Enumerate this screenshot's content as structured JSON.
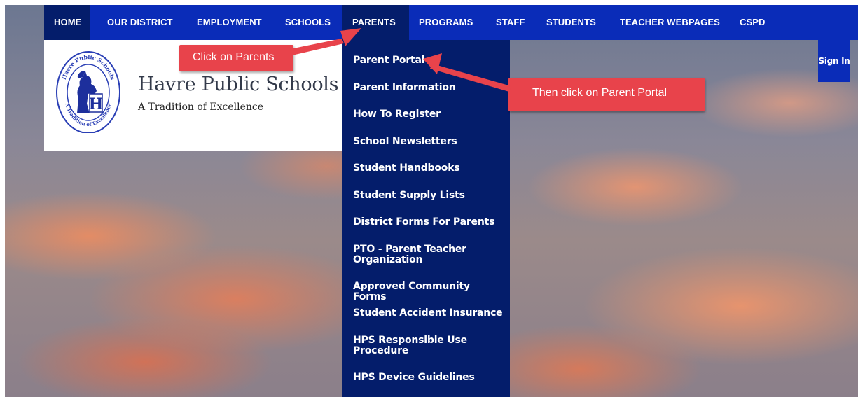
{
  "nav": {
    "items": [
      {
        "label": "HOME"
      },
      {
        "label": "OUR DISTRICT"
      },
      {
        "label": "EMPLOYMENT"
      },
      {
        "label": "SCHOOLS"
      },
      {
        "label": "PARENTS"
      },
      {
        "label": "PROGRAMS"
      },
      {
        "label": "STAFF"
      },
      {
        "label": "STUDENTS"
      },
      {
        "label": "TEACHER WEBPAGES"
      },
      {
        "label": "CSPD"
      }
    ],
    "active": "HOME",
    "open_menu": "PARENTS"
  },
  "site": {
    "title": "Havre Public Schools",
    "tagline": "A Tradition of Excellence",
    "seal_text_top": "Havre Public Schools",
    "seal_text_bottom": "A Tradition of Excellence"
  },
  "parents_menu": {
    "items": [
      {
        "label": "Parent Portal"
      },
      {
        "label": "Parent Information"
      },
      {
        "label": "How To Register"
      },
      {
        "label": "School Newsletters"
      },
      {
        "label": "Student Handbooks"
      },
      {
        "label": "Student Supply Lists"
      },
      {
        "label": "District Forms For Parents"
      },
      {
        "label": "PTO - Parent Teacher Organization"
      },
      {
        "label": "Approved Community Forms"
      },
      {
        "label": "Student Accident Insurance"
      },
      {
        "label": "HPS Responsible Use Procedure"
      },
      {
        "label": "HPS Device Guidelines"
      }
    ]
  },
  "signin": {
    "label": "Sign In"
  },
  "annotations": {
    "callout_1": "Click on Parents",
    "callout_2": "Then click on Parent Portal"
  },
  "colors": {
    "nav_bg": "#0a2cb8",
    "nav_active": "#041d6b",
    "dropdown_bg": "#041d6b",
    "callout": "#e8434b"
  }
}
